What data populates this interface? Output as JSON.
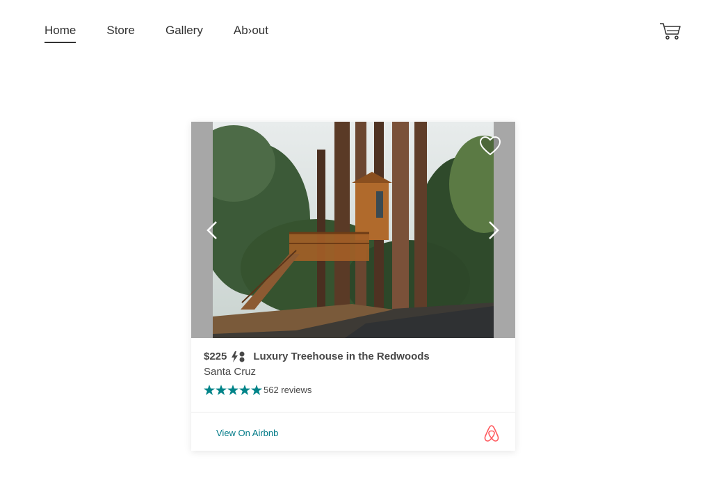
{
  "nav": {
    "items": [
      {
        "label": "Home"
      },
      {
        "label": "Store"
      },
      {
        "label": "Gallery"
      },
      {
        "label": "Ab›out"
      }
    ],
    "cart_icon": "shopping-cart-icon"
  },
  "listing": {
    "price": "$225",
    "title": "Luxury Treehouse in the Redwoods",
    "location": "Santa Cruz",
    "rating_stars": 5,
    "reviews": "562 reviews",
    "cta_label": "View On Airbnb",
    "instant_book_icon": "instant-book-icon",
    "favorite_icon": "heart-icon",
    "logo_icon": "airbnb-logo-icon"
  },
  "colors": {
    "teal": "#008489",
    "link": "#007a87",
    "brand": "#ff5a5f",
    "text": "#484848"
  }
}
